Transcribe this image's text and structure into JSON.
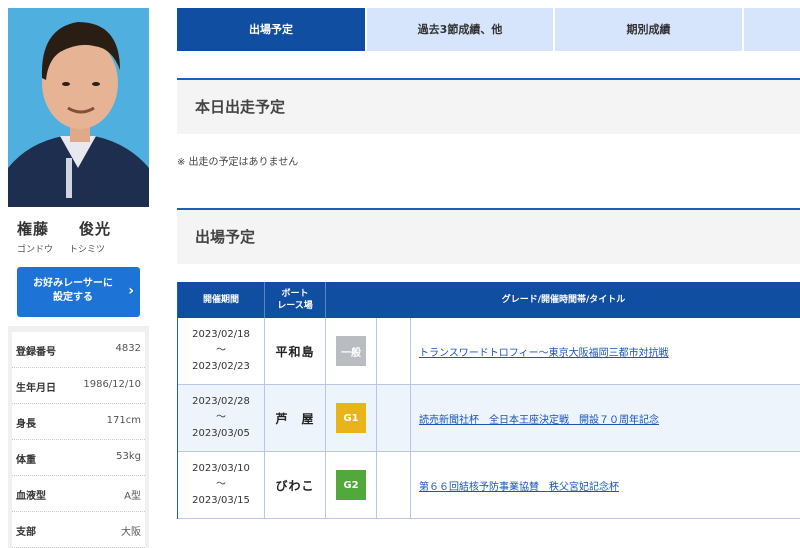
{
  "profile": {
    "surname": "権藤",
    "given_name": "俊光",
    "surname_kana": "ゴンドウ",
    "given_kana": "トシミツ",
    "fav_button_label": "お好みレーサーに設定する",
    "fav_button_line1": "お好みレーサーに",
    "fav_button_line2": "設定する",
    "rows": [
      {
        "label": "登録番号",
        "value": "4832"
      },
      {
        "label": "生年月日",
        "value": "1986/12/10"
      },
      {
        "label": "身長",
        "value": "171cm"
      },
      {
        "label": "体重",
        "value": "53kg"
      },
      {
        "label": "血液型",
        "value": "A型"
      },
      {
        "label": "支部",
        "value": "大阪"
      }
    ]
  },
  "tabs": [
    {
      "label": "出場予定",
      "active": true
    },
    {
      "label": "過去3節成績、他",
      "active": false
    },
    {
      "label": "期別成績",
      "active": false
    },
    {
      "label": "",
      "active": false
    }
  ],
  "today": {
    "heading": "本日出走予定",
    "note": "※ 出走の予定はありません"
  },
  "schedule": {
    "heading": "出場予定",
    "columns": {
      "period": "開催期間",
      "venue_line1": "ボート",
      "venue_line2": "レース場",
      "info": "グレード/開催時間帯/タイトル"
    },
    "rows": [
      {
        "start": "2023/02/18",
        "sep": "～",
        "end": "2023/02/23",
        "venue": "平和島",
        "grade": "一般",
        "grade_color": "#b9bcc0",
        "title": "トランスワードトロフィー～東京大阪福岡三都市対抗戦"
      },
      {
        "start": "2023/02/28",
        "sep": "～",
        "end": "2023/03/05",
        "venue": "芦　屋",
        "grade": "G1",
        "grade_color": "#e8b41a",
        "title": "読売新聞社杯　全日本王座決定戦　開設７０周年記念"
      },
      {
        "start": "2023/03/10",
        "sep": "～",
        "end": "2023/03/15",
        "venue": "びわこ",
        "grade": "G2",
        "grade_color": "#53a83c",
        "title": "第６６回結核予防事業協賛　秩父宮妃記念杯"
      }
    ]
  },
  "colors": {
    "tab_active": "#0f4ea0",
    "tab_inactive": "#d6e5fb",
    "button": "#1e74d6",
    "link": "#1a56b8"
  }
}
